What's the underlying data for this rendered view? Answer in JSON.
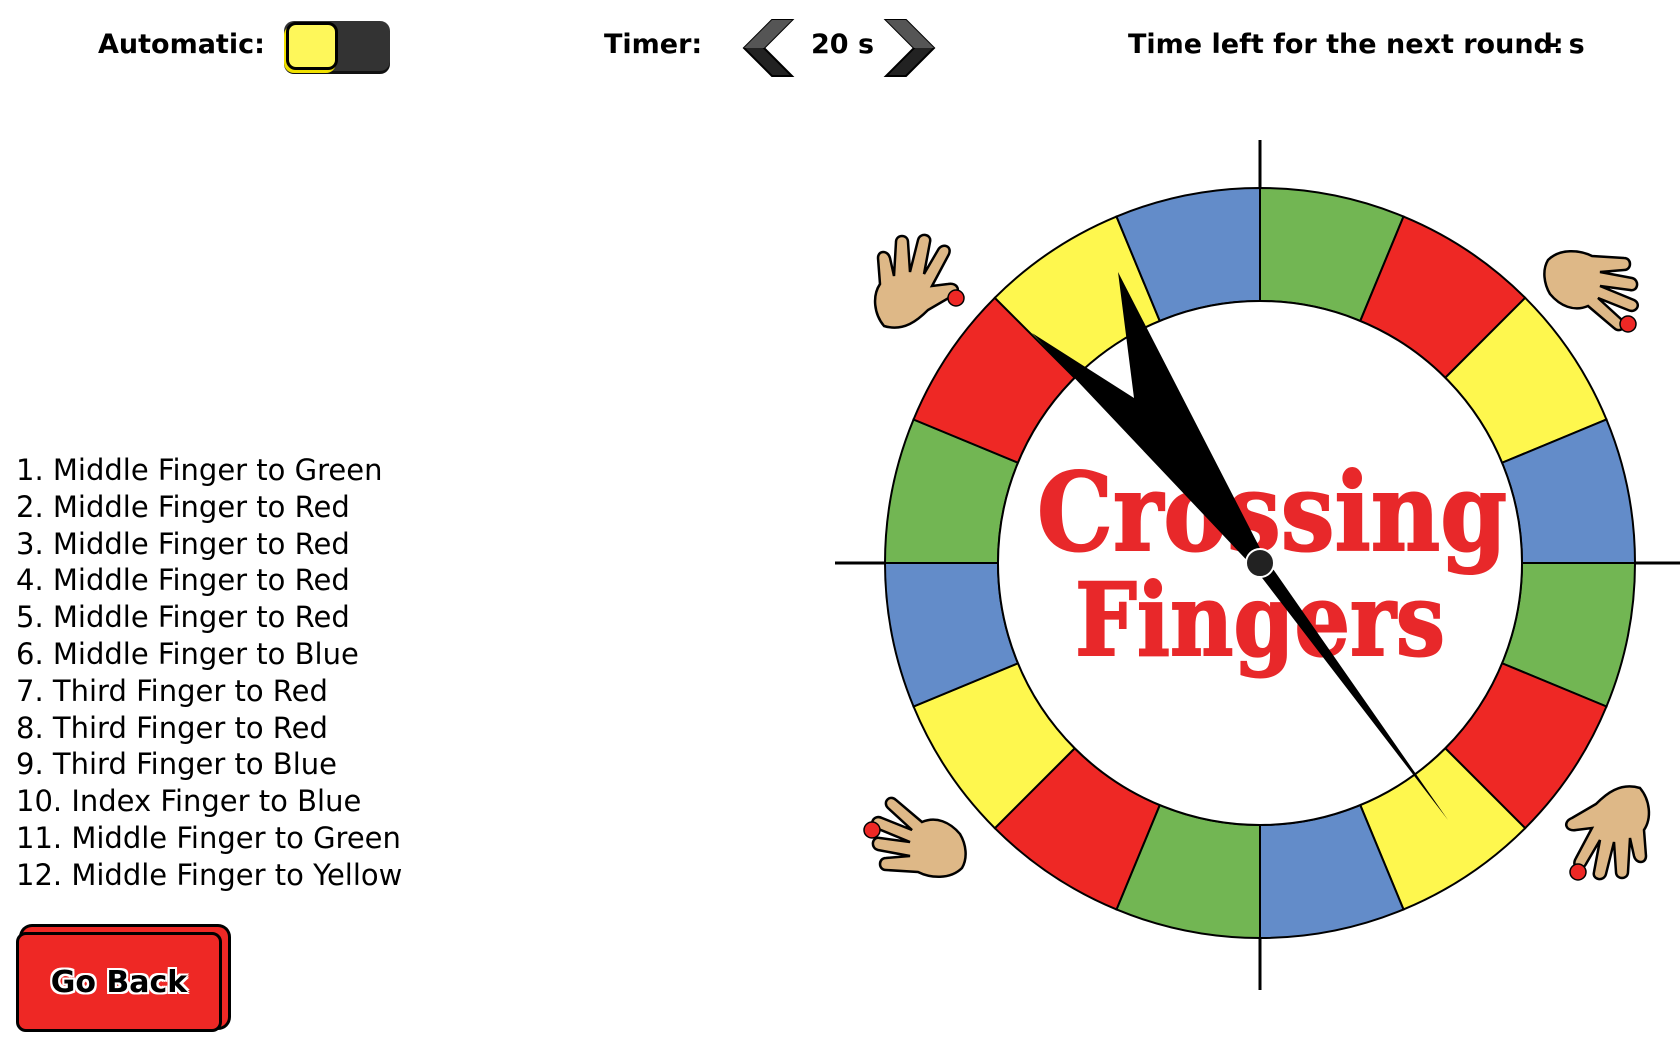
{
  "automatic": {
    "label": "Automatic:",
    "enabled": false,
    "knob_color": "#fef75a",
    "track_color": "#333333"
  },
  "timer": {
    "label": "Timer:",
    "value": "20 s",
    "prev_icon": "chevron-left-icon",
    "next_icon": "chevron-right-icon"
  },
  "next_round": {
    "label": "Time left for the next round:",
    "value": "- s"
  },
  "moves": [
    "1. Middle Finger to Green",
    "2. Middle Finger to Red",
    "3. Middle Finger to Red",
    "4. Middle Finger to Red",
    "5. Middle Finger to Red",
    "6. Middle Finger to Blue",
    "7. Third Finger to Red",
    "8. Third Finger to Red",
    "9. Third Finger to Blue",
    "10. Index Finger to Blue",
    "11. Middle Finger to Green",
    "12. Middle Finger to Yellow"
  ],
  "back_button": {
    "label": "Go Back"
  },
  "spinner": {
    "logo_line1": "Crossing",
    "logo_line2": "Fingers",
    "logo_color": "#e8282a",
    "segments": [
      "green",
      "red",
      "yellow",
      "blue",
      "green",
      "red",
      "yellow",
      "blue",
      "green",
      "red",
      "yellow",
      "blue",
      "green",
      "red",
      "yellow",
      "blue"
    ],
    "colors": {
      "green": "#72b653",
      "red": "#ee2825",
      "yellow": "#fef74e",
      "blue": "#638cc9"
    },
    "hands": [
      "top-left-hand-icon",
      "top-right-hand-icon",
      "bottom-left-hand-icon",
      "bottom-right-hand-icon"
    ]
  }
}
